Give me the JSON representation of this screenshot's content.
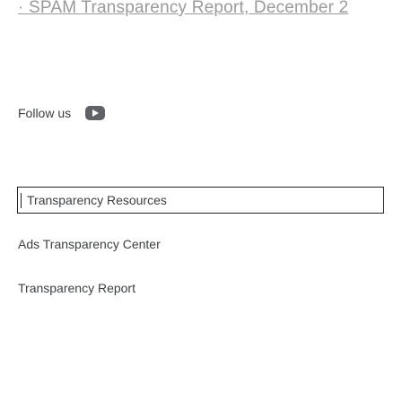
{
  "top_banner": {
    "partial_link_text": "· SPAM Transparency Report, December 2"
  },
  "follow": {
    "label": "Follow us",
    "icon": "youtube-icon"
  },
  "section": {
    "header": "Transparency Resources",
    "links": [
      "Ads Transparency Center",
      "Transparency Report"
    ]
  }
}
